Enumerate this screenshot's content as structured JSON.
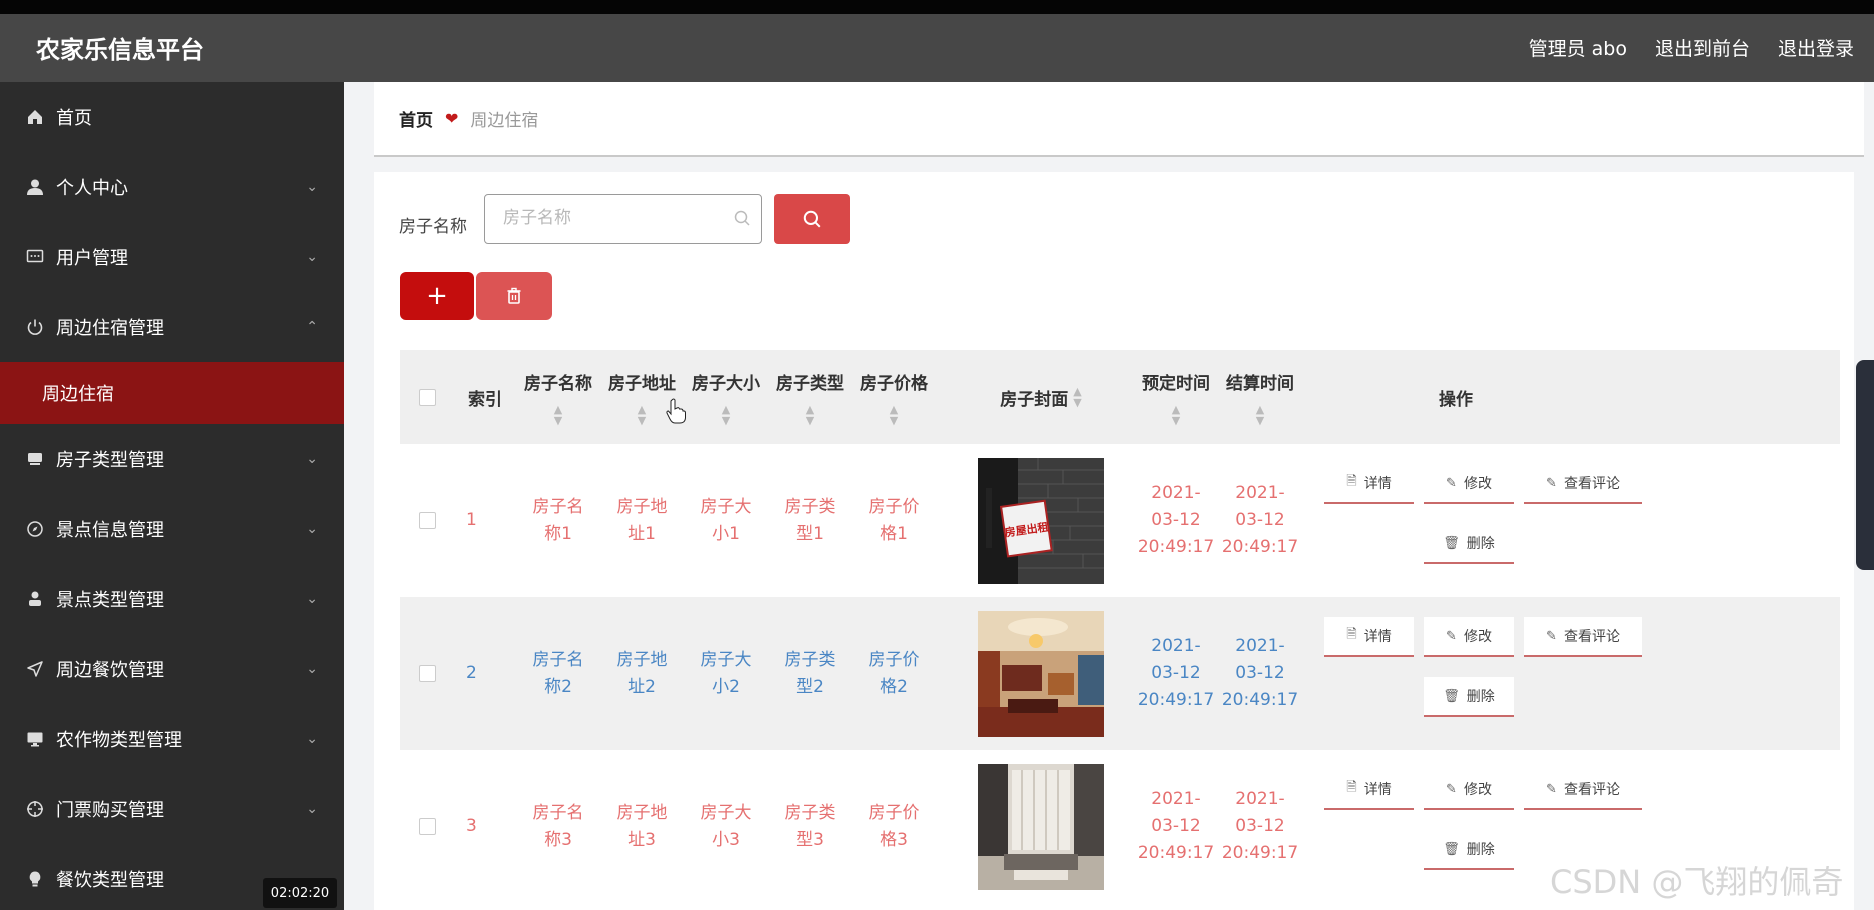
{
  "header": {
    "title": "农家乐信息平台",
    "admin_label": "管理员 abo",
    "exit_front": "退出到前台",
    "logout": "退出登录"
  },
  "sidebar": {
    "items": [
      {
        "label": "首页",
        "icon": "home-icon"
      },
      {
        "label": "个人中心",
        "icon": "user-icon"
      },
      {
        "label": "用户管理",
        "icon": "chat-icon"
      },
      {
        "label": "周边住宿管理",
        "icon": "power-icon"
      },
      {
        "label": "房子类型管理",
        "icon": "box-icon"
      },
      {
        "label": "景点信息管理",
        "icon": "compass-icon"
      },
      {
        "label": "景点类型管理",
        "icon": "person-icon"
      },
      {
        "label": "周边餐饮管理",
        "icon": "send-icon"
      },
      {
        "label": "农作物类型管理",
        "icon": "monitor-icon"
      },
      {
        "label": "门票购买管理",
        "icon": "target-icon"
      },
      {
        "label": "餐饮类型管理",
        "icon": "bulb-icon"
      }
    ],
    "submenu": {
      "label": "周边住宿"
    }
  },
  "breadcrumb": {
    "home": "首页",
    "current": "周边住宿"
  },
  "search": {
    "label": "房子名称",
    "placeholder": "房子名称",
    "value": ""
  },
  "toolbar": {
    "add_label": "+"
  },
  "table": {
    "headers": {
      "index": "索引",
      "name": "房子名称",
      "address": "房子地址",
      "size": "房子大小",
      "type": "房子类型",
      "price": "房子价格",
      "cover": "房子封面",
      "booking_time": "预定时间",
      "settle_time": "结算时间",
      "actions": "操作"
    },
    "rows": [
      {
        "index": "1",
        "name": "房子名称1",
        "address": "房子地址1",
        "size": "房子大小1",
        "type": "房子类型1",
        "price": "房子价格1",
        "booking_time": "2021-03-12 20:49:17",
        "settle_time": "2021-03-12 20:49:17"
      },
      {
        "index": "2",
        "name": "房子名称2",
        "address": "房子地址2",
        "size": "房子大小2",
        "type": "房子类型2",
        "price": "房子价格2",
        "booking_time": "2021-03-12 20:49:17",
        "settle_time": "2021-03-12 20:49:17"
      },
      {
        "index": "3",
        "name": "房子名称3",
        "address": "房子地址3",
        "size": "房子大小3",
        "type": "房子类型3",
        "price": "房子价格3",
        "booking_time": "2021-03-12 20:49:17",
        "settle_time": "2021-03-12 20:49:17"
      }
    ],
    "actions": {
      "detail": "详情",
      "edit": "修改",
      "view_comments": "查看评论",
      "delete": "删除"
    },
    "cover_sign_text": "房屋出租"
  },
  "overlay": {
    "timestamp": "02:02:20",
    "watermark": "CSDN @飞翔的佩奇"
  },
  "colors": {
    "accent": "#c40d0d",
    "header_bg": "#474747",
    "sidebar_bg": "#2c2c2c",
    "active_submenu": "#8b1414",
    "odd_row_text": "#e57070",
    "even_row_text": "#4a86c4"
  }
}
